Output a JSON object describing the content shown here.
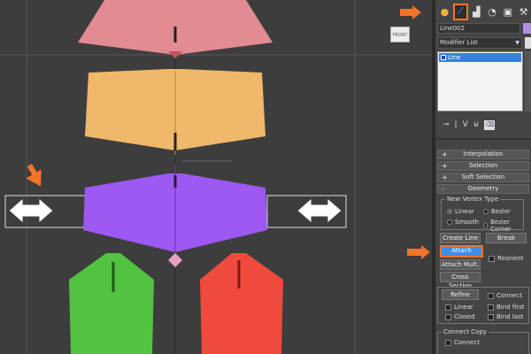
{
  "viewport": {
    "viewcube_label": "FRONT"
  },
  "panel": {
    "tabs": [
      {
        "name": "create-tab",
        "glyph": "●"
      },
      {
        "name": "modify-tab",
        "glyph": "⟋"
      },
      {
        "name": "hierarchy-tab",
        "glyph": "▟"
      },
      {
        "name": "motion-tab",
        "glyph": "◔"
      },
      {
        "name": "display-tab",
        "glyph": "▣"
      },
      {
        "name": "utilities-tab",
        "glyph": "⚒"
      }
    ],
    "object_name": "Line002",
    "object_color": "#b48be8",
    "modifier_list": "Modifier List",
    "stack_item": "Line",
    "stackbar_icons": [
      "⊸",
      "|",
      "Ⅴ",
      "⊌",
      "⌫"
    ],
    "rollouts": [
      "Interpolation",
      "Selection",
      "Soft Selection",
      "Geometry"
    ],
    "rollout_signs": [
      "+",
      "+",
      "+",
      "-"
    ],
    "vertex_group_title": "New Vertex Type",
    "radio": {
      "linear": "Linear",
      "bezier": "Bezier",
      "smooth": "Smooth",
      "bezier_corner": "Bezier Corner"
    },
    "buttons": {
      "create_line": "Create Line",
      "break": "Break",
      "attach": "Attach",
      "reorient": "Reorient",
      "attach_mult": "Attach Mult.",
      "cross_section": "Cross Section",
      "refine": "Refine",
      "connect": "Connect",
      "linear": "Linear",
      "bind_first": "Bind first",
      "closed": "Closed",
      "bind_last": "Bind last"
    },
    "connect_copy_title": "Connect Copy",
    "connect_copy_check": "Connect"
  }
}
